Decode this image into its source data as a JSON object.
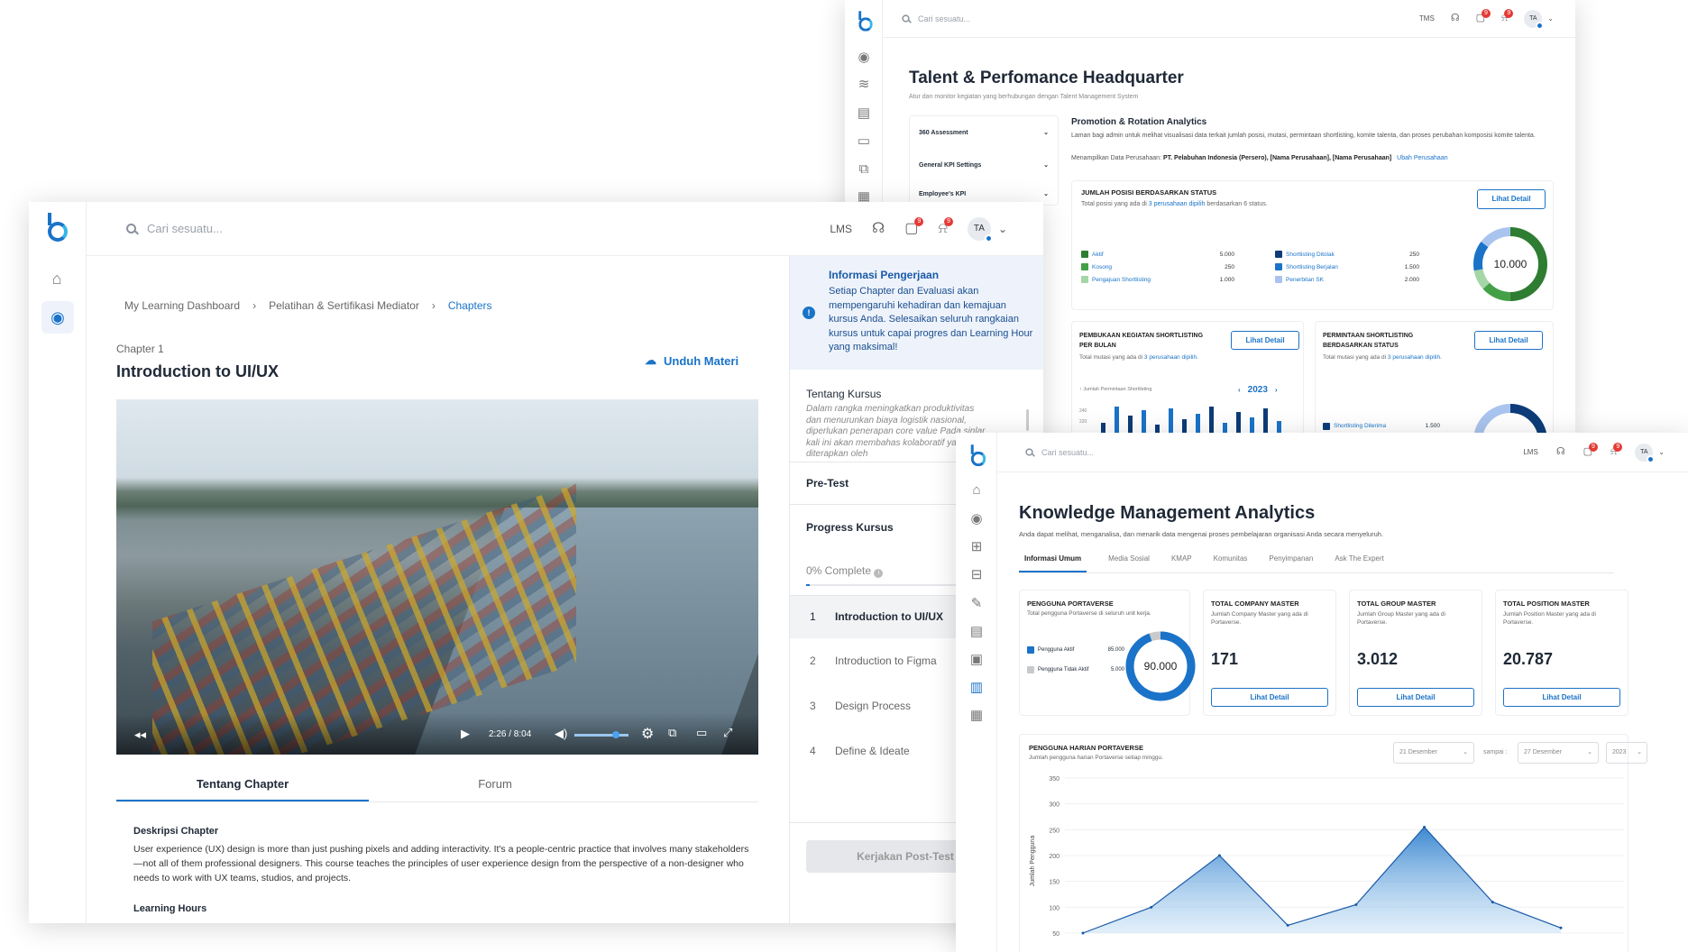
{
  "talent": {
    "search_placeholder": "Cari sesuatu...",
    "tms": "TMS",
    "avatar": "TA",
    "badge1": "9",
    "badge2": "9",
    "title": "Talent & Perfomance Headquarter",
    "subtitle": "Atur dan monitor kegiatan yang berhubungan dengan Talent Management System",
    "accordion": [
      "360 Assessment",
      "General KPI Settings",
      "Employee's KPI"
    ],
    "promo_title": "Promotion & Rotation Analytics",
    "promo_desc": "Laman bagi admin untuk melihat visualisasi data terkait jumlah posisi, mutasi, permintaan shortlisting, komite talenta, dan proses perubahan komposisi komite talenta.",
    "company_label": "Menampilkan Data Perusahaan:",
    "company_value": "PT. Pelabuhan Indonesia (Persero), [Nama Perusahaan], [Nama Perusahaan]",
    "company_link": "Ubah Perusahaan",
    "posisi_title": "JUMLAH POSISI BERDASARKAN STATUS",
    "posisi_sub_a": "Total posisi yang ada di",
    "posisi_sub_link": "3 perusahaan dipilih",
    "posisi_sub_b": "berdasarkan 6 status.",
    "lihat_detail": "Lihat Detail",
    "legend_left": [
      {
        "label": "Aktif",
        "value": "5.000",
        "color": "#2e7d32"
      },
      {
        "label": "Kosong",
        "value": "250",
        "color": "#43a047"
      },
      {
        "label": "Pengajuan Shortlisting",
        "value": "1.000",
        "color": "#a5d6a7"
      }
    ],
    "legend_right": [
      {
        "label": "Shortlisting Ditolak",
        "value": "250",
        "color": "#0d3c78"
      },
      {
        "label": "Shortlisting Berjalan",
        "value": "1.500",
        "color": "#1a73c8"
      },
      {
        "label": "Penerbitan SK",
        "value": "2.000",
        "color": "#a9c4ee"
      }
    ],
    "donut_total": "10.000",
    "pembukaan_title": "PEMBUKAAN KEGIATAN SHORTLISTING PER BULAN",
    "mutasi_sub_a": "Total mutasi yang ada di",
    "mutasi_sub_link": "3 perusahaan dipilih.",
    "permintaan_title": "PERMINTAAN SHORTLISTING BERDASARKAN STATUS",
    "chart_axis": "Jumlah Permintaan Shortlisting",
    "year": "2023",
    "y_ticks": [
      "240",
      "220"
    ],
    "sl_diterima": "Shortlisting Diterima",
    "sl_diterima_val": "1.500"
  },
  "lms": {
    "search_placeholder": "Cari sesuatu...",
    "lms": "LMS",
    "avatar": "TA",
    "badge1": "9",
    "badge2": "9",
    "breadcrumb": [
      "My Learning Dashboard",
      "Pelatihan & Sertifikasi Mediator",
      "Chapters"
    ],
    "chapter_label": "Chapter 1",
    "chapter_title": "Introduction to UI/UX",
    "download": "Unduh Materi",
    "video_time": "2:26 / 8:04",
    "tabs": [
      "Tentang Chapter",
      "Forum"
    ],
    "desc_title": "Deskripsi Chapter",
    "desc_text": "User experience (UX) design is more than just pushing pixels and adding interactivity. It's a people-centric practice that involves many stakeholders—not all of them professional designers. This course teaches the principles of user experience design from the perspective of a non-designer who needs to work with UX teams, studios, and projects.",
    "hours_title": "Learning Hours",
    "info_title": "Informasi Pengerjaan",
    "info_text": "Setiap Chapter dan Evaluasi akan mempengaruhi kehadiran dan kemajuan kursus Anda. Selesaikan seluruh rangkaian kursus untuk capai progres dan Learning Hour yang maksimal!",
    "tentang_title": "Tentang Kursus",
    "tentang_text": "Dalam rangka meningkatkan produktivitas dan menurunkan biaya logistik nasional, diperlukan penerapan core value Pada sinlar kali ini akan membahas kolaboratif yang diterapkan oleh",
    "pretest": "Pre-Test",
    "progress_title": "Progress Kursus",
    "progress_text": "0% Complete",
    "progress_value": 0.02,
    "chapters": [
      {
        "num": "1",
        "title": "Introduction to UI/UX"
      },
      {
        "num": "2",
        "title": "Introduction to Figma"
      },
      {
        "num": "3",
        "title": "Design Process"
      },
      {
        "num": "4",
        "title": "Define & Ideate"
      }
    ],
    "posttest": "Kerjakan Post-Test"
  },
  "km": {
    "search_placeholder": "Cari sesuatu...",
    "lms": "LMS",
    "avatar": "TA",
    "badge1": "9",
    "badge2": "9",
    "title": "Knowledge Management Analytics",
    "subtitle": "Anda dapat melihat, menganalisa, dan menarik data mengenai proses pembelajaran organisasi Anda secara menyeluruh.",
    "tabs": [
      "Informasi Umum",
      "Media Sosial",
      "KMAP",
      "Komunitas",
      "Penyimpanan",
      "Ask The Expert"
    ],
    "pengguna_title": "PENGGUNA PORTAVERSE",
    "pengguna_sub": "Total pengguna Portaverse di seluruh unit kerja.",
    "aktif_label": "Pengguna Aktif",
    "aktif_value": "85.000",
    "tidak_label": "Pengguna Tidak Aktif",
    "tidak_value": "5.000",
    "donut_total": "90.000",
    "stats": [
      {
        "title": "TOTAL COMPANY MASTER",
        "sub": "Jumlah Company Master yang ada di Portaverse.",
        "value": "171"
      },
      {
        "title": "TOTAL GROUP MASTER",
        "sub": "Jumlah Group Master yang ada di Portaverse.",
        "value": "3.012"
      },
      {
        "title": "TOTAL POSITION MASTER",
        "sub": "Jumlah Position Master yang ada di Portaverse.",
        "value": "20.787"
      }
    ],
    "lihat_detail": "Lihat Detail",
    "harian_title": "PENGGUNA HARIAN PORTAVERSE",
    "harian_sub": "Jumlah pengguna harian Portaverse setiap minggu.",
    "date_from": "21 Desember",
    "sampai": "sampai :",
    "date_to": "27 Desember",
    "year": "2023"
  },
  "chart_data": {
    "type": "area",
    "ylabel": "Jumlah Pengguna",
    "y_ticks": [
      350,
      300,
      250,
      200,
      150,
      100,
      50
    ],
    "ylim": [
      50,
      350
    ],
    "values": [
      50,
      100,
      200,
      65,
      105,
      255,
      110,
      60
    ]
  }
}
